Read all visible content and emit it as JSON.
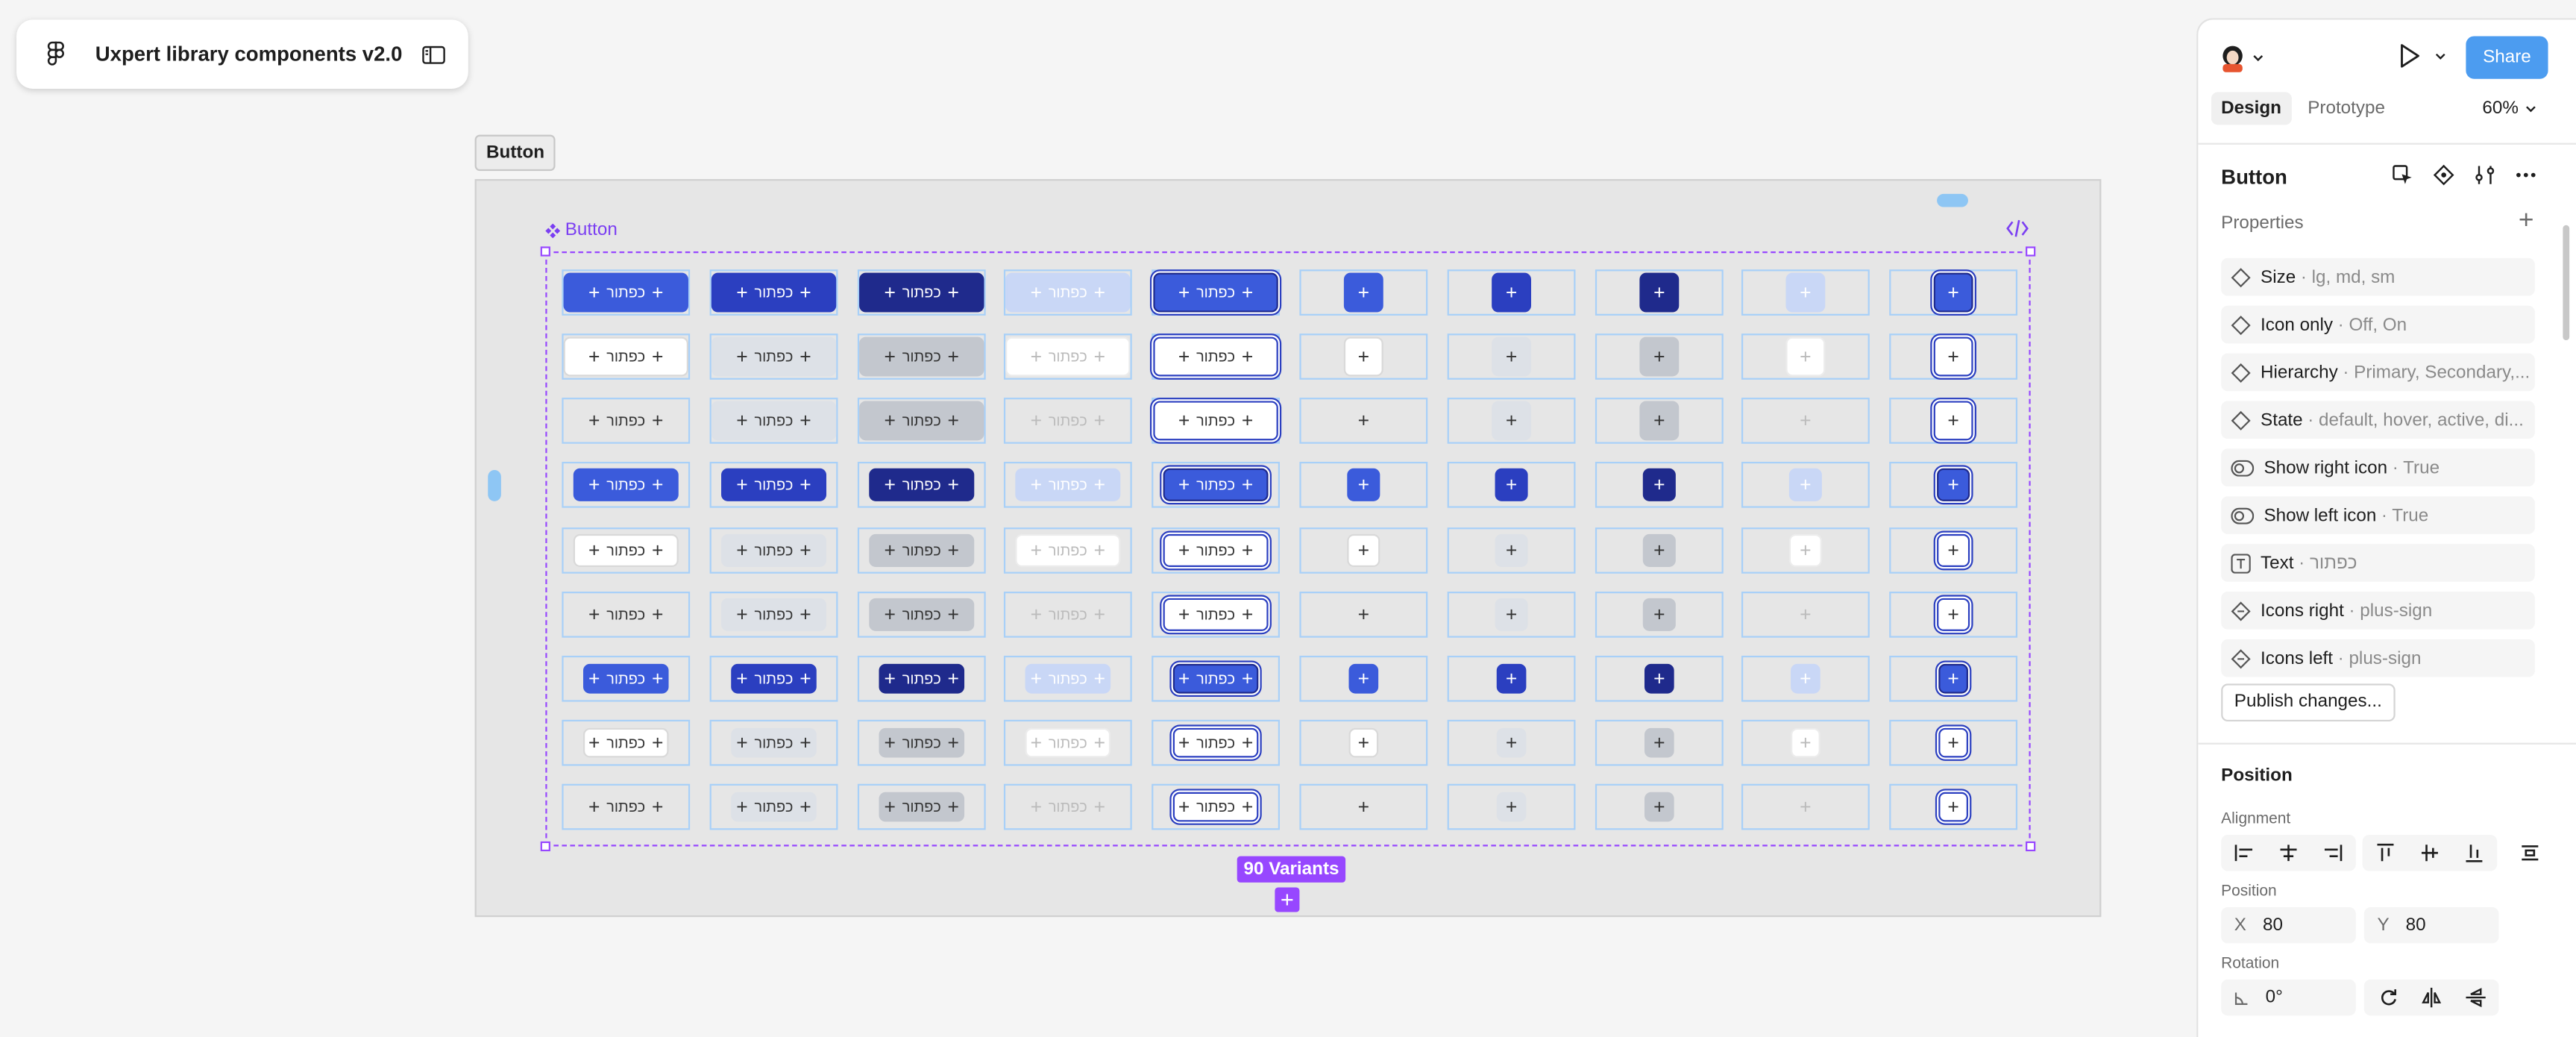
{
  "file": {
    "title": "Uxpert library components v2.0",
    "logo_icon": "figma-logo-icon",
    "sidebar_toggle_icon": "sidebar-toggle-icon"
  },
  "canvas": {
    "frame_label": "Button",
    "component_name": "Button",
    "variants_badge": "90 Variants",
    "add_variant": "+",
    "button_text": "כפתור",
    "plus_glyph": "+",
    "rows": 9,
    "columns": 10,
    "colors": {
      "primary": "#3b5bdb",
      "primary_dark": "#2b3fc0",
      "primary_darker": "#1f2a8c",
      "disabled": "#c9d7f6",
      "gray": "#dde1e7",
      "gray_dark": "#c3c7ce",
      "selection": "#9747ff",
      "cell_outline": "#a8d0f8"
    }
  },
  "panel": {
    "tabs": [
      {
        "label": "Design",
        "active": true
      },
      {
        "label": "Prototype",
        "active": false
      }
    ],
    "zoom": "60%",
    "share_label": "Share",
    "component_title": "Button",
    "properties_title": "Properties",
    "properties": [
      {
        "icon": "variant-diamond-icon",
        "name": "Size",
        "value": "· lg, md, sm"
      },
      {
        "icon": "variant-diamond-icon",
        "name": "Icon only",
        "value": "· Off, On"
      },
      {
        "icon": "variant-diamond-icon",
        "name": "Hierarchy",
        "value": "· Primary, Secondary,..."
      },
      {
        "icon": "variant-diamond-icon",
        "name": "State",
        "value": "· default, hover, active, di..."
      },
      {
        "icon": "boolean-toggle-icon",
        "name": "Show right icon",
        "value": "· True"
      },
      {
        "icon": "boolean-toggle-icon",
        "name": "Show left icon",
        "value": "· True"
      },
      {
        "icon": "text-property-icon",
        "name": "Text",
        "value": "· כפתור"
      },
      {
        "icon": "instance-swap-icon",
        "name": "Icons right",
        "value": "· plus-sign"
      },
      {
        "icon": "instance-swap-icon",
        "name": "Icons left",
        "value": "· plus-sign"
      }
    ],
    "publish_label": "Publish changes...",
    "position_title": "Position",
    "alignment_label": "Alignment",
    "position_label": "Position",
    "x_label": "X",
    "x_value": "80",
    "y_label": "Y",
    "y_value": "80",
    "rotation_label": "Rotation",
    "rotation_value": "0°"
  }
}
